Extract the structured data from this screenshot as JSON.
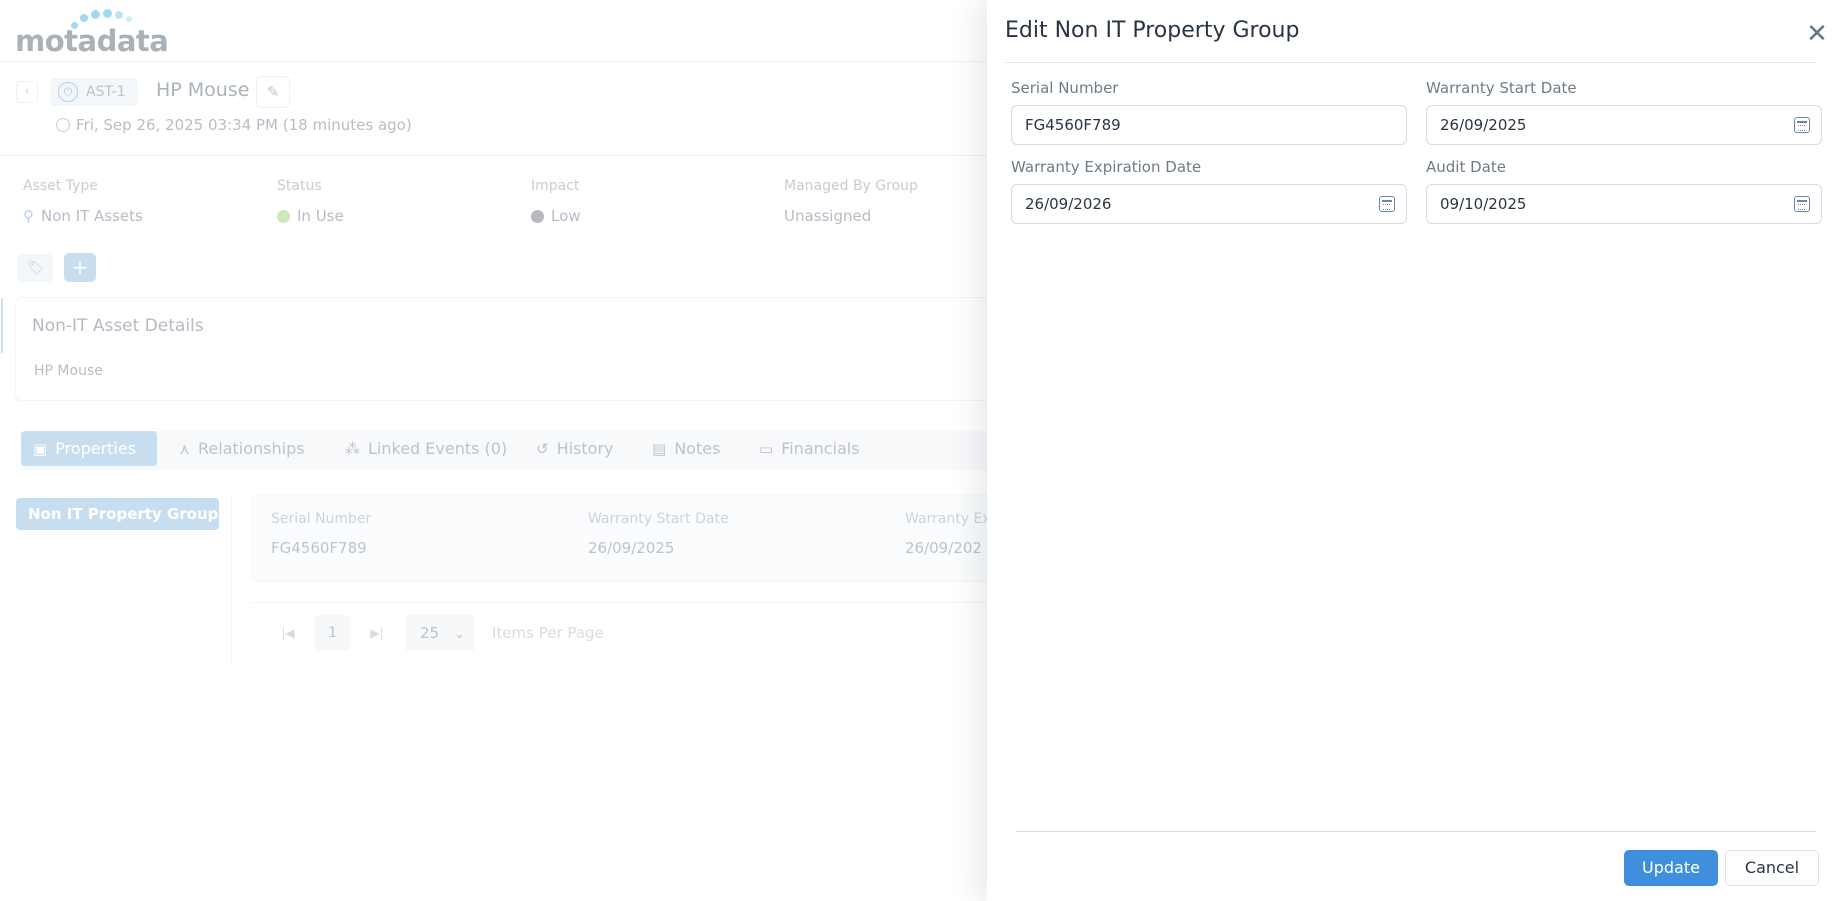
{
  "app": {
    "logo_text": "motadata"
  },
  "asset": {
    "id": "AST-1",
    "name": "HP Mouse",
    "created": "Fri, Sep 26, 2025 03:34 PM (18 minutes ago)"
  },
  "meta": [
    {
      "label": "Asset Type",
      "value": "Non IT Assets",
      "icon": "non-it-asset-icon"
    },
    {
      "label": "Status",
      "value": "In Use",
      "color": "#b9dc9a"
    },
    {
      "label": "Impact",
      "value": "Low",
      "color": "#8f969d"
    },
    {
      "label": "Managed By Group",
      "value": "Unassigned"
    }
  ],
  "details": {
    "title": "Non-IT Asset Details",
    "value": "HP Mouse"
  },
  "tabs": [
    {
      "label": "Properties",
      "icon": "properties-icon"
    },
    {
      "label": "Relationships",
      "icon": "relationships-icon"
    },
    {
      "label": "Linked Events (0)",
      "icon": "linked-events-icon"
    },
    {
      "label": "History",
      "icon": "history-icon"
    },
    {
      "label": "Notes",
      "icon": "notes-icon"
    },
    {
      "label": "Financials",
      "icon": "financials-icon"
    }
  ],
  "property_group": {
    "name": "Non IT Property Group",
    "fields": [
      {
        "label": "Serial Number",
        "value": "FG4560F789"
      },
      {
        "label": "Warranty Start Date",
        "value": "26/09/2025"
      },
      {
        "label": "Warranty Ex",
        "value": "26/09/202"
      }
    ]
  },
  "pagination": {
    "page": "1",
    "page_size": "25",
    "label": "Items Per Page"
  },
  "drawer": {
    "title": "Edit Non IT Property Group",
    "fields": [
      {
        "label": "Serial Number",
        "value": "FG4560F789"
      },
      {
        "label": "Warranty Start Date",
        "value": "26/09/2025"
      },
      {
        "label": "Warranty Expiration Date",
        "value": "26/09/2026"
      },
      {
        "label": "Audit Date",
        "value": "09/10/2025"
      }
    ],
    "update_label": "Update",
    "cancel_label": "Cancel"
  }
}
